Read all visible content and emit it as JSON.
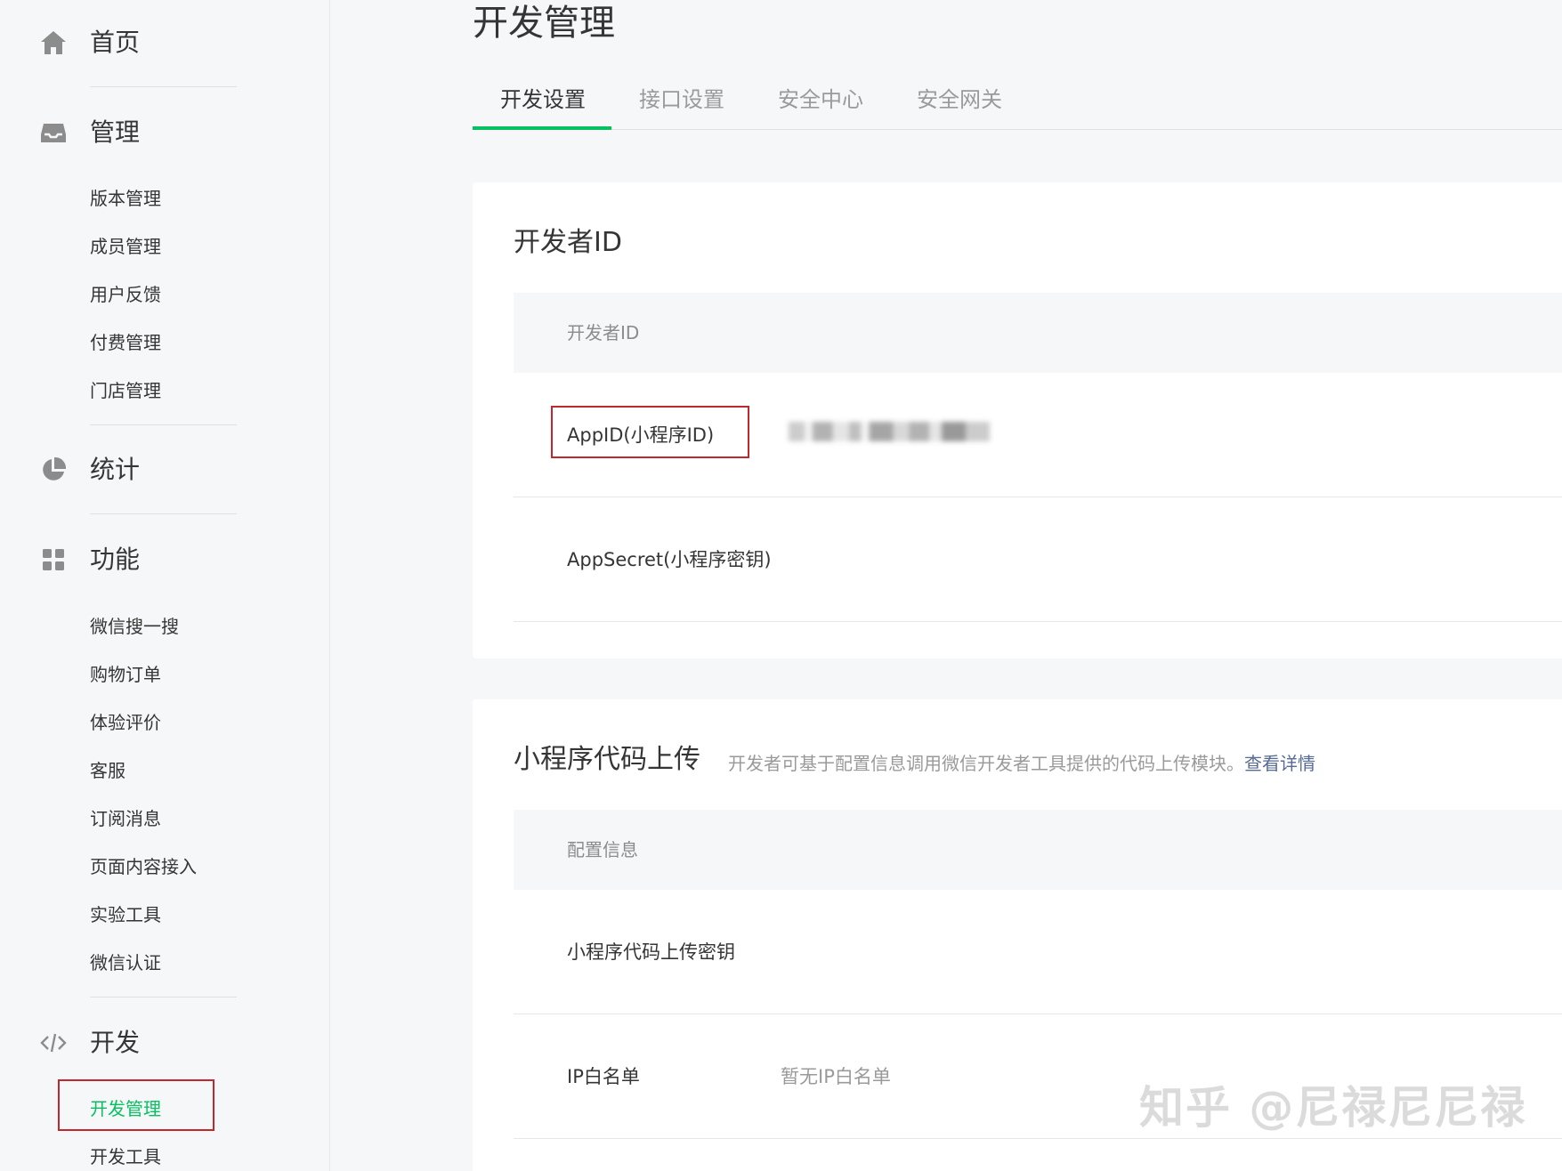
{
  "sidebar": {
    "home": {
      "label": "首页"
    },
    "manage": {
      "label": "管理",
      "items": [
        "版本管理",
        "成员管理",
        "用户反馈",
        "付费管理",
        "门店管理"
      ]
    },
    "stats": {
      "label": "统计"
    },
    "features": {
      "label": "功能",
      "items": [
        "微信搜一搜",
        "购物订单",
        "体验评价",
        "客服",
        "订阅消息",
        "页面内容接入",
        "实验工具",
        "微信认证"
      ]
    },
    "dev": {
      "label": "开发",
      "items": [
        "开发管理",
        "开发工具"
      ],
      "active_item": "开发管理"
    }
  },
  "main": {
    "title": "开发管理",
    "tabs": [
      {
        "label": "开发设置",
        "active": true
      },
      {
        "label": "接口设置",
        "active": false
      },
      {
        "label": "安全中心",
        "active": false
      },
      {
        "label": "安全网关",
        "active": false
      }
    ],
    "developer_card": {
      "title": "开发者ID",
      "table_header": "开发者ID",
      "rows": [
        {
          "label": "AppID(小程序ID)",
          "value": ""
        },
        {
          "label": "AppSecret(小程序密钥)",
          "value": ""
        }
      ]
    },
    "upload_card": {
      "title": "小程序代码上传",
      "desc": "开发者可基于配置信息调用微信开发者工具提供的代码上传模块。",
      "desc_link": "查看详情",
      "table_header": "配置信息",
      "rows": [
        {
          "label": "小程序代码上传密钥",
          "value": ""
        },
        {
          "label": "IP白名单",
          "value": "暂无IP白名单"
        }
      ]
    }
  },
  "watermark": "知乎 @尼禄尼尼禄",
  "colors": {
    "accent": "#07c160",
    "highlight_box": "#c0282d",
    "link": "#576b95"
  }
}
